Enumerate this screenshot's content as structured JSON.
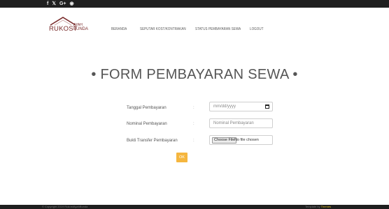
{
  "topbar": {
    "social": [
      "f",
      "𝕏",
      "G+",
      "◉"
    ],
    "social_icons": [
      "facebook-icon",
      "twitter-icon",
      "google-plus-icon",
      "instagram-icon"
    ]
  },
  "brand": {
    "name": "RUKOST",
    "sub1": "AYAH",
    "sub2": "BUNDA"
  },
  "nav": {
    "items": [
      "BERANDA",
      "SEPUTAR KOST/KONTRAKAN",
      "STATUS PEMBAYARAN SEWA",
      "LOGOUT"
    ]
  },
  "form": {
    "title": "• FORM PEMBAYARAN SEWA •",
    "labels": {
      "tanggal": "Tanggal Pembayaran",
      "nominal": "Nominal Pembayaran",
      "bukti": "Bukti Transfer Pembayaran"
    },
    "colon": ":",
    "date_placeholder": "mm/dd/yyyy",
    "nominal_placeholder": "Nominal Pembayaran",
    "file_button": "Choose File",
    "file_status": "No file chosen",
    "submit": "OK"
  },
  "footer": {
    "left": "© Copyright 2019 RukostAyahBunda",
    "right_prefix": "Template by ",
    "right_link": "Themes"
  },
  "colors": {
    "accent": "#f5b63f",
    "brand": "#7a2c2c",
    "bar": "#1f1f1f"
  }
}
